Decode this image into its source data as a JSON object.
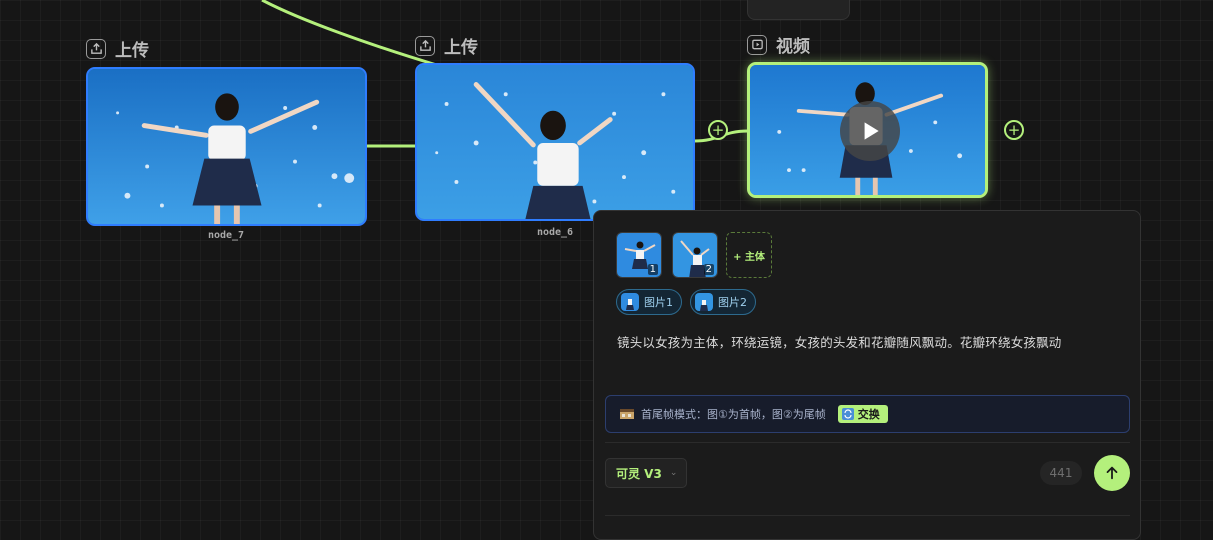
{
  "nodes": {
    "upload_a": {
      "label": "上传",
      "caption": "node_7",
      "icon": "upload-icon"
    },
    "upload_b": {
      "label": "上传",
      "caption": "node_6",
      "icon": "upload-icon"
    },
    "video": {
      "label": "视频",
      "icon": "video-icon",
      "play_icon": "play-icon"
    }
  },
  "ports": {
    "symbol": "+"
  },
  "panel": {
    "thumbnails": [
      {
        "number": "1"
      },
      {
        "number": "2"
      }
    ],
    "add_subject_label": "+ 主体",
    "ref_tags": [
      {
        "label": "图片1"
      },
      {
        "label": "图片2"
      }
    ],
    "prompt": "镜头以女孩为主体，环绕运镜，女孩的头发和花瓣随风飘动。花瓣环绕女孩飘动",
    "mode_text": "首尾帧模式：图①为首帧，图②为尾帧",
    "swap_label": "交换",
    "model_label": "可灵 V3",
    "count": "441"
  },
  "colors": {
    "accent": "#b4f07c",
    "image_border": "#2f7dff",
    "background": "#161616",
    "sky": "#1f7ed6"
  }
}
